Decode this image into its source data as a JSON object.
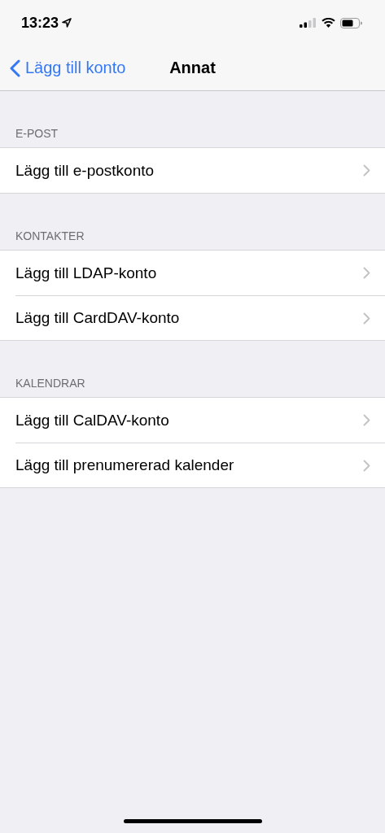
{
  "status_bar": {
    "time": "13:23"
  },
  "nav_bar": {
    "back": "Lägg till konto",
    "title": "Annat"
  },
  "sections": [
    {
      "header": "E-POST",
      "rows": [
        {
          "label": "Lägg till e-postkonto"
        }
      ]
    },
    {
      "header": "KONTAKTER",
      "rows": [
        {
          "label": "Lägg till LDAP-konto"
        },
        {
          "label": "Lägg till CardDAV-konto"
        }
      ]
    },
    {
      "header": "KALENDRAR",
      "rows": [
        {
          "label": "Lägg till CalDAV-konto"
        },
        {
          "label": "Lägg till prenumererad kalender"
        }
      ]
    }
  ]
}
